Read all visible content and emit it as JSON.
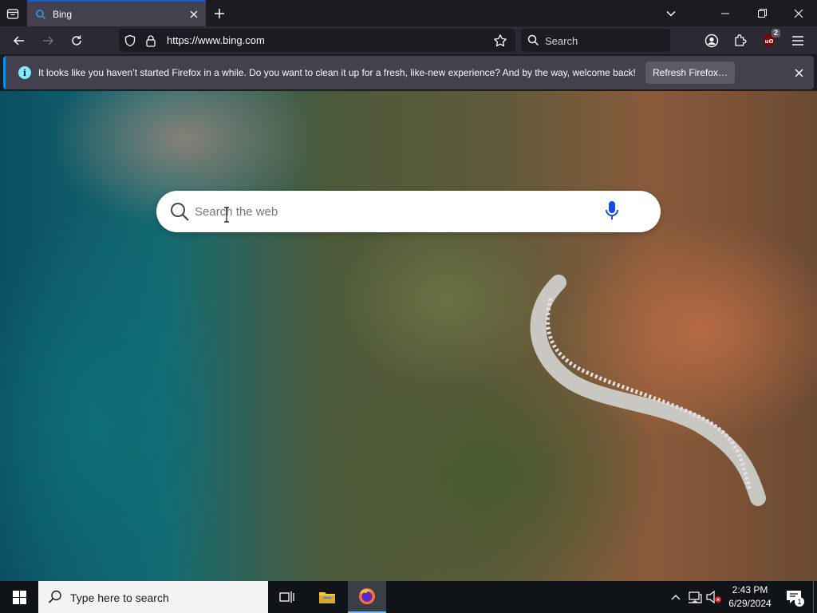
{
  "tab": {
    "title": "Bing"
  },
  "urlbar": {
    "url": "https://www.bing.com"
  },
  "searchbar": {
    "placeholder": "Search"
  },
  "toolbar": {
    "extension_badge": "2"
  },
  "notification": {
    "message": "It looks like you haven’t started Firefox in a while. Do you want to clean it up for a fresh, like-new experience? And by the way, welcome back!",
    "button_label": "Refresh Firefox…"
  },
  "page": {
    "search_placeholder": "Search the web"
  },
  "taskbar": {
    "search_placeholder": "Type here to search",
    "time": "2:43 PM",
    "date": "6/29/2024",
    "notification_count": "1"
  },
  "colors": {
    "tab_accent": "#0060df",
    "chrome_dark": "#1c1b22",
    "toolbar": "#2b2a33",
    "info_icon": "#80ebff",
    "bing_mic": "#174ae4",
    "taskbar": "#101418"
  }
}
